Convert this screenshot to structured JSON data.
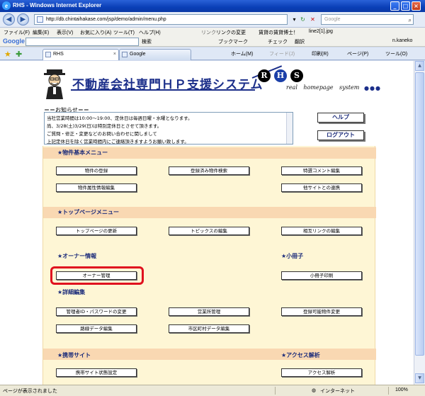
{
  "window": {
    "title": "RHS - Windows Internet Explorer",
    "url": "http://db.chintaihakase.com/jsp/demo/admin/menu.php",
    "search_placeholder": "Google"
  },
  "menubar": {
    "items": [
      "ファイル(F)",
      "編集(E)",
      "表示(V)",
      "お気に入り(A)",
      "ツール(T)",
      "ヘルプ(H)"
    ],
    "links_label": "リンク",
    "links": [
      "リンクの変更",
      "賃貸の賃貸博士！",
      "line2[1].jpg"
    ]
  },
  "googlebar": {
    "logo": "Google",
    "items": [
      "検索",
      "ブックマーク",
      "チェック",
      "翻訳"
    ],
    "user": "n.kaneko"
  },
  "tabs": [
    {
      "label": "RHS",
      "active": true
    },
    {
      "label": "Google",
      "active": false
    }
  ],
  "commandbar": {
    "items": [
      "ホーム(M)",
      "フィード(J)",
      "印刷(R)",
      "ページ(P)",
      "ツール(O)"
    ]
  },
  "header": {
    "site_title": "不動産会社専門ＨＰ支援システム",
    "letters": [
      "R",
      "H",
      "S"
    ],
    "tagline": "real homepage system",
    "dots": "●●●"
  },
  "notice": {
    "title": "＝＝お知らせ＝＝",
    "lines": [
      "当社営業時間は10:00～19:00、定休日は毎週日曜・水曜となります。",
      "尚、3/28(土)3/29(日)は特別定休日とさせて頂きます。",
      "ご質問・修正・変更などのお問い合わせに関しまして",
      "上記定休日を除く営業時間内にご連絡頂きますようお願い致します。"
    ]
  },
  "actions": {
    "help": "ヘルプ",
    "logout": "ログアウト"
  },
  "sections": {
    "property": {
      "title": "★物件基本メニュー",
      "buttons": [
        "物件の登録",
        "登録済み物件検索",
        "特選コメント編集",
        "物件属性情報編集",
        "他サイトとの連携"
      ]
    },
    "toppage": {
      "title": "★トップページメニュー",
      "buttons": [
        "トップページの更新",
        "トピックスの編集",
        "相互リンクの編集"
      ]
    },
    "owner": {
      "title": "★オーナー情報",
      "buttons": [
        "オーナー管理"
      ]
    },
    "booklet": {
      "title": "★小冊子",
      "buttons": [
        "小冊子印刷"
      ]
    },
    "detail": {
      "title": "★詳細編集",
      "buttons": [
        "管理者ID・パスワードの変更",
        "営業所管理",
        "登録可能物件変更",
        "路線データ編集",
        "市区町村データ編集"
      ]
    },
    "mobile": {
      "title": "★携帯サイト",
      "buttons": [
        "携帯サイト状態設定"
      ]
    },
    "access": {
      "title": "★アクセス解析",
      "buttons": [
        "アクセス解析"
      ]
    }
  },
  "status": {
    "text": "ページが表示されました",
    "zone": "インターネット",
    "zoom": "100%"
  },
  "colors": {
    "title_blue": "#1c2f8a",
    "panel_bg": "#fef6d5",
    "section_bar": "#f9d8b2",
    "highlight": "#e0101e"
  }
}
